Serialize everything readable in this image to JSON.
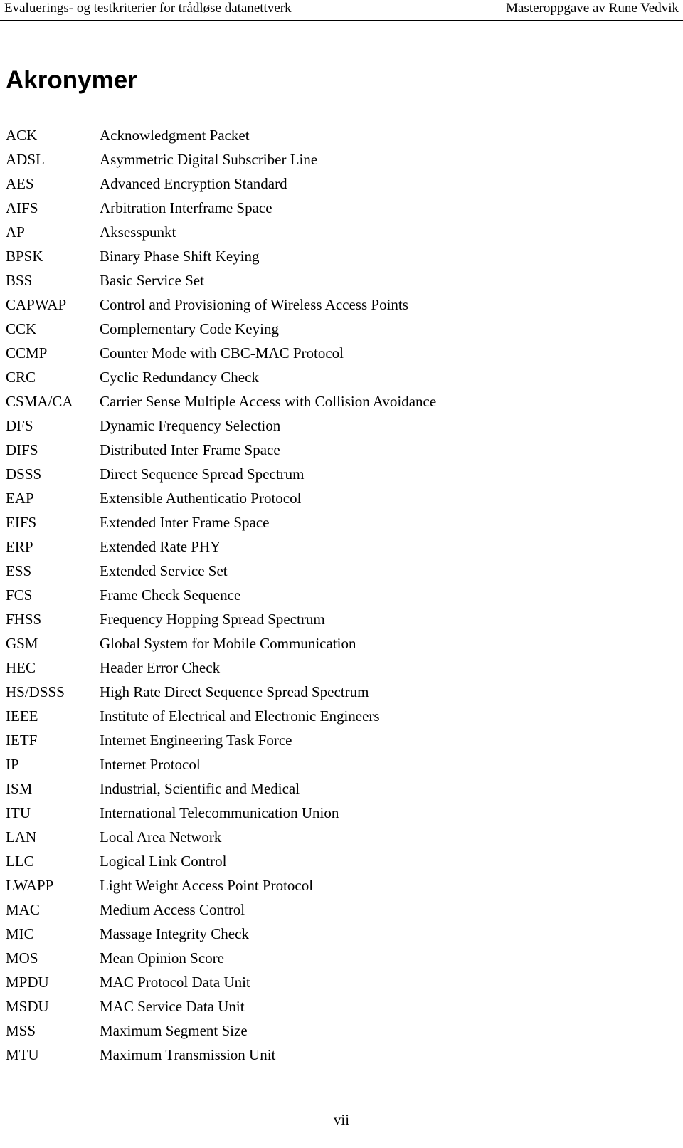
{
  "header": {
    "left_text": "Evaluerings- og testkriterier for trådløse datanettverk",
    "right_text": "Masteroppgave av Rune Vedvik"
  },
  "title": "Akronymer",
  "acronyms": [
    {
      "term": "ACK",
      "definition": "Acknowledgment Packet"
    },
    {
      "term": "ADSL",
      "definition": "Asymmetric Digital Subscriber Line"
    },
    {
      "term": "AES",
      "definition": "Advanced Encryption Standard"
    },
    {
      "term": "AIFS",
      "definition": "Arbitration Interframe Space"
    },
    {
      "term": "AP",
      "definition": "Aksesspunkt"
    },
    {
      "term": "BPSK",
      "definition": "Binary Phase Shift Keying"
    },
    {
      "term": "BSS",
      "definition": "Basic Service Set"
    },
    {
      "term": "CAPWAP",
      "definition": "Control and Provisioning of Wireless Access Points"
    },
    {
      "term": "CCK",
      "definition": "Complementary Code Keying"
    },
    {
      "term": "CCMP",
      "definition": "Counter Mode with CBC-MAC Protocol"
    },
    {
      "term": "CRC",
      "definition": "Cyclic Redundancy Check"
    },
    {
      "term": "CSMA/CA",
      "definition": "Carrier Sense Multiple Access with Collision Avoidance"
    },
    {
      "term": "DFS",
      "definition": "Dynamic Frequency Selection"
    },
    {
      "term": "DIFS",
      "definition": "Distributed Inter Frame Space"
    },
    {
      "term": "DSSS",
      "definition": "Direct Sequence Spread Spectrum"
    },
    {
      "term": "EAP",
      "definition": "Extensible Authenticatio Protocol"
    },
    {
      "term": "EIFS",
      "definition": "Extended Inter Frame Space"
    },
    {
      "term": "ERP",
      "definition": "Extended Rate PHY"
    },
    {
      "term": "ESS",
      "definition": "Extended Service Set"
    },
    {
      "term": "FCS",
      "definition": "Frame Check Sequence"
    },
    {
      "term": "FHSS",
      "definition": "Frequency Hopping Spread Spectrum"
    },
    {
      "term": "GSM",
      "definition": "Global System for Mobile Communication"
    },
    {
      "term": "HEC",
      "definition": "Header Error Check"
    },
    {
      "term": "HS/DSSS",
      "definition": "High Rate Direct Sequence Spread Spectrum"
    },
    {
      "term": "IEEE",
      "definition": "Institute of Electrical and Electronic Engineers"
    },
    {
      "term": "IETF",
      "definition": "Internet Engineering Task Force"
    },
    {
      "term": "IP",
      "definition": "Internet Protocol"
    },
    {
      "term": "ISM",
      "definition": "Industrial, Scientific and Medical"
    },
    {
      "term": "ITU",
      "definition": "International Telecommunication Union"
    },
    {
      "term": "LAN",
      "definition": "Local Area Network"
    },
    {
      "term": "LLC",
      "definition": "Logical Link Control"
    },
    {
      "term": "LWAPP",
      "definition": "Light Weight Access Point Protocol"
    },
    {
      "term": "MAC",
      "definition": "Medium Access Control"
    },
    {
      "term": "MIC",
      "definition": "Massage Integrity Check"
    },
    {
      "term": "MOS",
      "definition": "Mean Opinion Score"
    },
    {
      "term": "MPDU",
      "definition": "MAC Protocol Data Unit"
    },
    {
      "term": "MSDU",
      "definition": "MAC Service Data Unit"
    },
    {
      "term": "MSS",
      "definition": "Maximum Segment Size"
    },
    {
      "term": "MTU",
      "definition": "Maximum Transmission Unit"
    }
  ],
  "footer": {
    "page_number": "vii"
  }
}
